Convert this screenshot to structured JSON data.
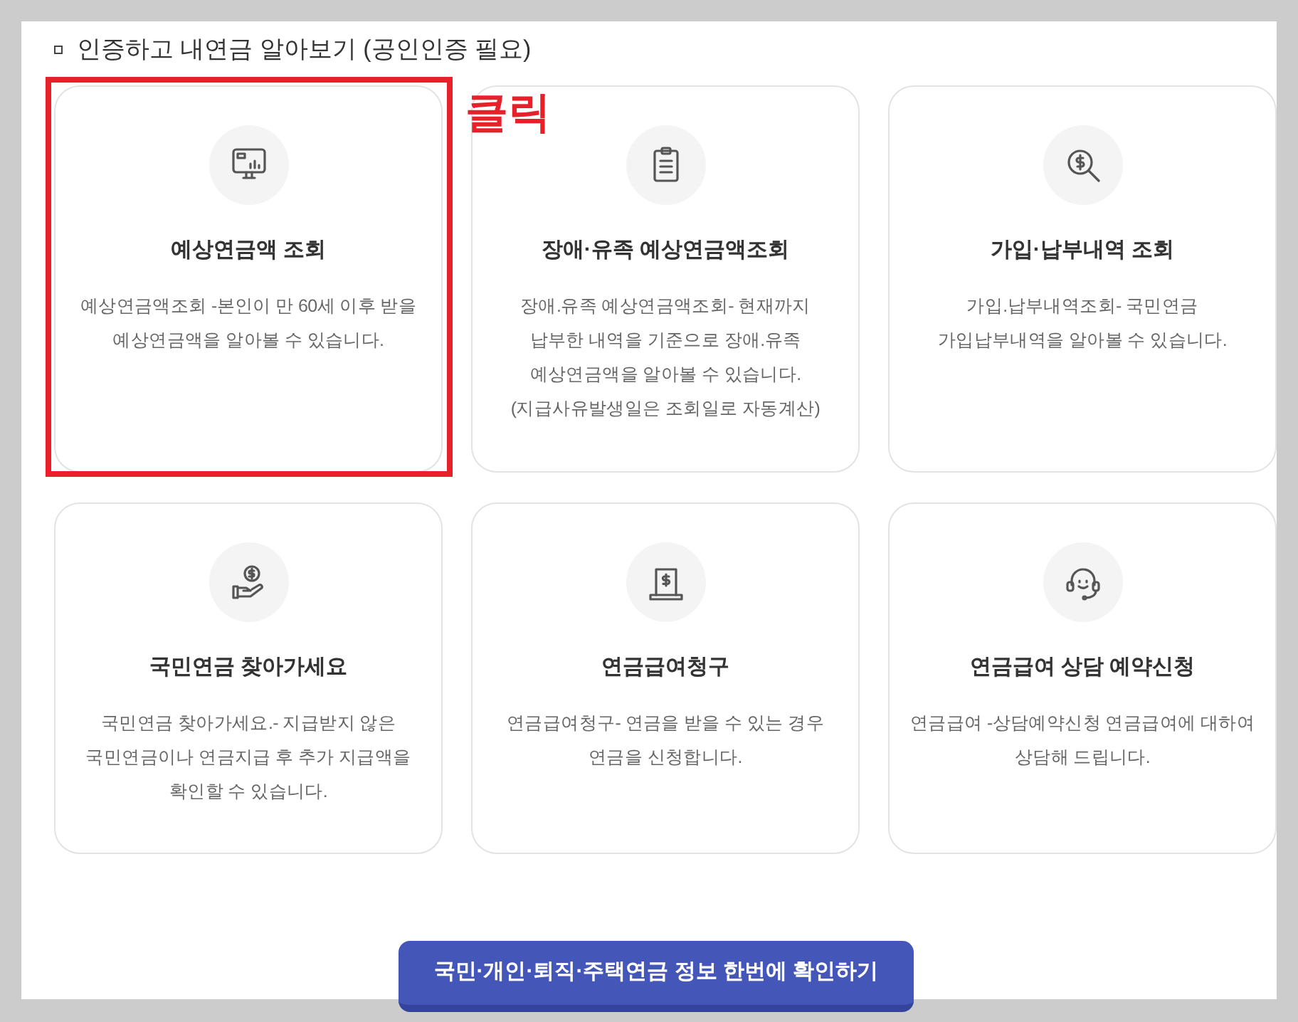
{
  "section_title": "인증하고 내연금 알아보기 (공인인증 필요)",
  "annotation": {
    "text": "클릭"
  },
  "cards": [
    {
      "title": "예상연금액 조회",
      "description": [
        "예상연금액조회 -본인이 만 60세 이후 받을",
        "예상연금액을 알아볼 수 있습니다."
      ],
      "highlighted": true
    },
    {
      "title": "장애·유족 예상연금액조회",
      "description": [
        "장애.유족 예상연금액조회- 현재까지",
        "납부한 내역을 기준으로 장애.유족",
        "예상연금액을 알아볼 수 있습니다.",
        "(지급사유발생일은 조회일로 자동계산)"
      ],
      "highlighted": false
    },
    {
      "title": "가입·납부내역 조회",
      "description": [
        "가입.납부내역조회- 국민연금",
        "가입납부내역을 알아볼 수 있습니다."
      ],
      "highlighted": false
    },
    {
      "title": "국민연금 찾아가세요",
      "description": [
        "국민연금 찾아가세요.- 지급받지 않은",
        "국민연금이나 연금지급 후 추가 지급액을",
        "확인할 수 있습니다."
      ],
      "highlighted": false
    },
    {
      "title": "연금급여청구",
      "description": [
        "연금급여청구- 연금을 받을 수 있는 경우",
        "연금을 신청합니다."
      ],
      "highlighted": false
    },
    {
      "title": "연금급여 상담 예약신청",
      "description": [
        "연금급여 -상담예약신청 연금급여에 대하여",
        "상담해 드립니다."
      ],
      "highlighted": false
    }
  ],
  "bottom_button": {
    "label": "국민·개인·퇴직·주택연금 정보 한번에 확인하기"
  }
}
